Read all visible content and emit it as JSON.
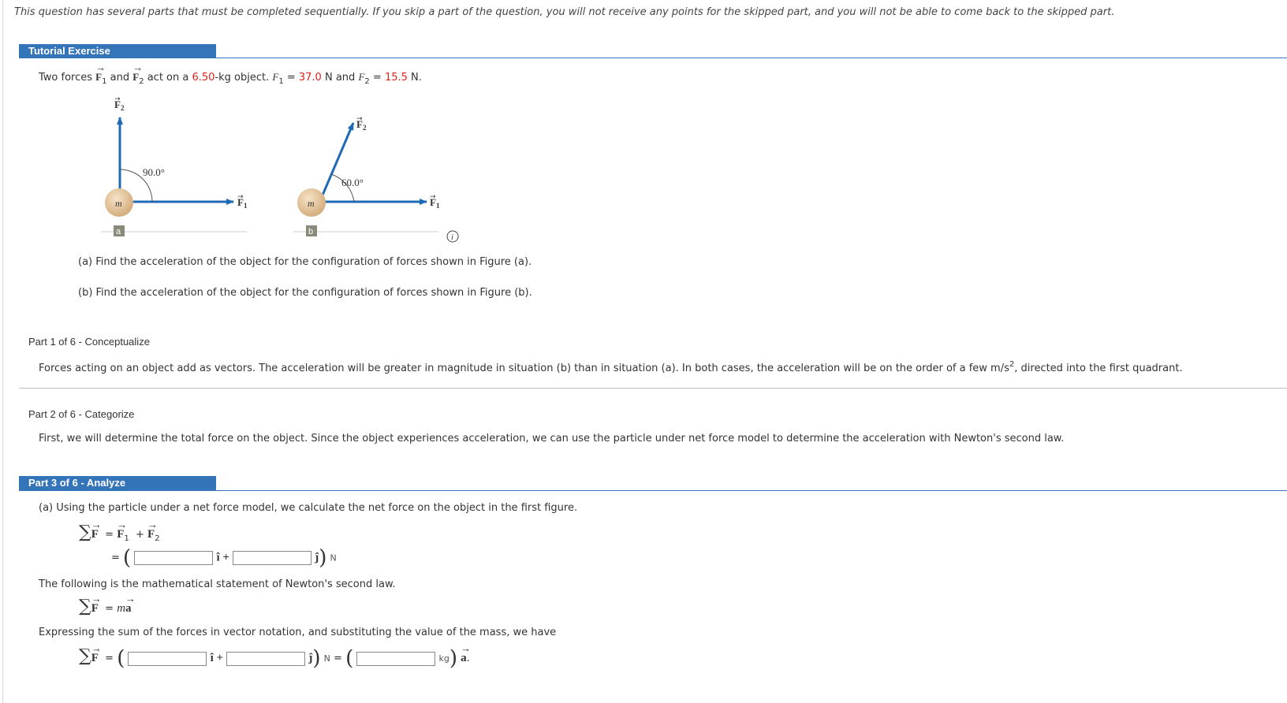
{
  "intro": "This question has several parts that must be completed sequentially. If you skip a part of the question, you will not receive any points for the skipped part, and you will not be able to come back to the skipped part.",
  "tutorial": {
    "header": "Tutorial Exercise",
    "problem_prefix": "Two forces",
    "problem_and": "and",
    "problem_act": "act on a",
    "mass": "6.50",
    "problem_mid": "-kg object.",
    "f1_label": "F",
    "f1_value": "37.0",
    "f2_value": "15.5",
    "unit_n": "N",
    "and_word": "and",
    "question_a": "(a) Find the acceleration of the object for the configuration of forces shown in Figure (a).",
    "question_b": "(b) Find the acceleration of the object for the configuration of forces shown in Figure (b)."
  },
  "figure": {
    "angle_a": "90.0°",
    "angle_b": "60.0°",
    "mass_label": "m",
    "label_a": "a",
    "label_b": "b",
    "force1": "F",
    "force2": "F",
    "sub1": "1",
    "sub2": "2",
    "colors": {
      "arrow": "#1f6ab4",
      "mass": "#e2c39a",
      "label_bg": "#8a8a7a"
    }
  },
  "part1": {
    "title": "Part 1 of 6 - Conceptualize",
    "body_pre": "Forces acting on an object add as vectors. The acceleration will be greater in magnitude in situation (b) than in situation (a). In both cases, the acceleration will be on the order of a few m/s",
    "body_sup": "2",
    "body_post": ", directed into the first quadrant."
  },
  "part2": {
    "title": "Part 2 of 6 - Categorize",
    "body": "First, we will determine the total force on the object. Since the object experiences acceleration, we can use the particle under net force model to determine the acceleration with Newton's second law."
  },
  "part3": {
    "title": "Part 3 of 6 - Analyze",
    "line_a": "(a) Using the particle under a net force model, we calculate the net force on the object in the first figure.",
    "newton_text": "The following is the mathematical statement of Newton's second law.",
    "expressing_text": "Expressing the sum of the forces in vector notation, and substituting the value of the mass, we have",
    "i_hat": "î +",
    "j_hat": "ĵ",
    "n_unit": "N",
    "kg_unit": "kg",
    "a_vec": "a",
    "ma": "ma",
    "inputs": {
      "fx_a": "",
      "fy_a": "",
      "fx_b": "",
      "fy_b": "",
      "mass": ""
    }
  },
  "info_icon": "info-icon"
}
